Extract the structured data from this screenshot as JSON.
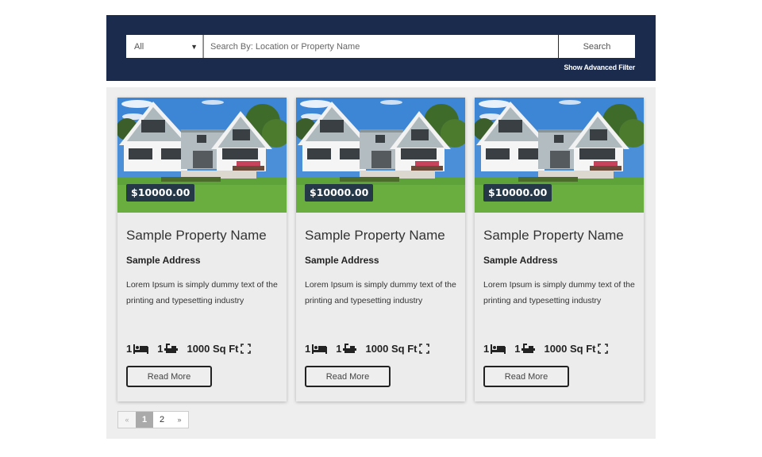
{
  "search": {
    "category_selected": "All",
    "placeholder": "Search By: Location or Property Name",
    "value": "",
    "button_label": "Search",
    "advanced_filter_label": "Show Advanced Filter"
  },
  "listings": [
    {
      "price": "$10000.00",
      "name": "Sample Property Name",
      "address": "Sample Address",
      "description": "Lorem Ipsum is simply dummy text of the printing and typesetting industry",
      "beds": "1",
      "baths": "1",
      "area": "1000 Sq Ft",
      "button_label": "Read More"
    },
    {
      "price": "$10000.00",
      "name": "Sample Property Name",
      "address": "Sample Address",
      "description": "Lorem Ipsum is simply dummy text of the printing and typesetting industry",
      "beds": "1",
      "baths": "1",
      "area": "1000 Sq Ft",
      "button_label": "Read More"
    },
    {
      "price": "$10000.00",
      "name": "Sample Property Name",
      "address": "Sample Address",
      "description": "Lorem Ipsum is simply dummy text of the printing and typesetting industry",
      "beds": "1",
      "baths": "1",
      "area": "1000 Sq Ft",
      "button_label": "Read More"
    }
  ],
  "pagination": {
    "prev": "«",
    "pages": [
      "1",
      "2"
    ],
    "current": "1",
    "next": "»"
  },
  "colors": {
    "header_bg": "#1b2b4d",
    "price_badge_bg": "#243847",
    "content_bg": "#eeeeee"
  }
}
